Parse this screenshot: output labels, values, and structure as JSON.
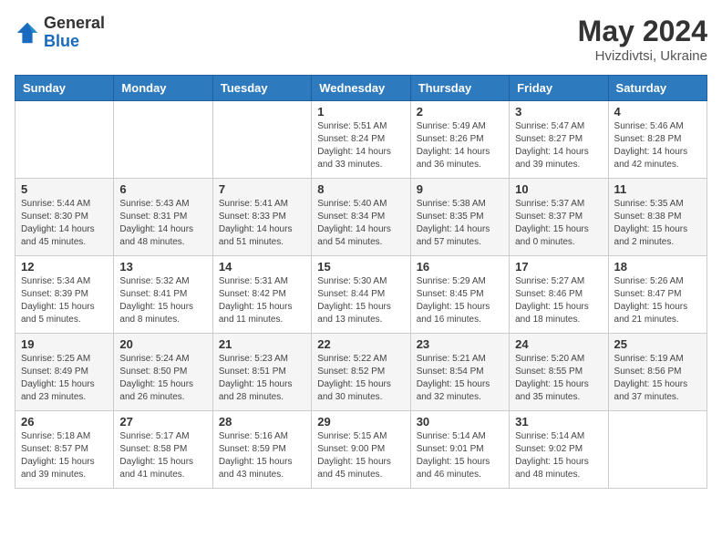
{
  "logo": {
    "general": "General",
    "blue": "Blue"
  },
  "title": {
    "month": "May 2024",
    "location": "Hvizdivtsi, Ukraine"
  },
  "weekdays": [
    "Sunday",
    "Monday",
    "Tuesday",
    "Wednesday",
    "Thursday",
    "Friday",
    "Saturday"
  ],
  "weeks": [
    [
      {
        "day": "",
        "sunrise": "",
        "sunset": "",
        "daylight": ""
      },
      {
        "day": "",
        "sunrise": "",
        "sunset": "",
        "daylight": ""
      },
      {
        "day": "",
        "sunrise": "",
        "sunset": "",
        "daylight": ""
      },
      {
        "day": "1",
        "sunrise": "Sunrise: 5:51 AM",
        "sunset": "Sunset: 8:24 PM",
        "daylight": "Daylight: 14 hours and 33 minutes."
      },
      {
        "day": "2",
        "sunrise": "Sunrise: 5:49 AM",
        "sunset": "Sunset: 8:26 PM",
        "daylight": "Daylight: 14 hours and 36 minutes."
      },
      {
        "day": "3",
        "sunrise": "Sunrise: 5:47 AM",
        "sunset": "Sunset: 8:27 PM",
        "daylight": "Daylight: 14 hours and 39 minutes."
      },
      {
        "day": "4",
        "sunrise": "Sunrise: 5:46 AM",
        "sunset": "Sunset: 8:28 PM",
        "daylight": "Daylight: 14 hours and 42 minutes."
      }
    ],
    [
      {
        "day": "5",
        "sunrise": "Sunrise: 5:44 AM",
        "sunset": "Sunset: 8:30 PM",
        "daylight": "Daylight: 14 hours and 45 minutes."
      },
      {
        "day": "6",
        "sunrise": "Sunrise: 5:43 AM",
        "sunset": "Sunset: 8:31 PM",
        "daylight": "Daylight: 14 hours and 48 minutes."
      },
      {
        "day": "7",
        "sunrise": "Sunrise: 5:41 AM",
        "sunset": "Sunset: 8:33 PM",
        "daylight": "Daylight: 14 hours and 51 minutes."
      },
      {
        "day": "8",
        "sunrise": "Sunrise: 5:40 AM",
        "sunset": "Sunset: 8:34 PM",
        "daylight": "Daylight: 14 hours and 54 minutes."
      },
      {
        "day": "9",
        "sunrise": "Sunrise: 5:38 AM",
        "sunset": "Sunset: 8:35 PM",
        "daylight": "Daylight: 14 hours and 57 minutes."
      },
      {
        "day": "10",
        "sunrise": "Sunrise: 5:37 AM",
        "sunset": "Sunset: 8:37 PM",
        "daylight": "Daylight: 15 hours and 0 minutes."
      },
      {
        "day": "11",
        "sunrise": "Sunrise: 5:35 AM",
        "sunset": "Sunset: 8:38 PM",
        "daylight": "Daylight: 15 hours and 2 minutes."
      }
    ],
    [
      {
        "day": "12",
        "sunrise": "Sunrise: 5:34 AM",
        "sunset": "Sunset: 8:39 PM",
        "daylight": "Daylight: 15 hours and 5 minutes."
      },
      {
        "day": "13",
        "sunrise": "Sunrise: 5:32 AM",
        "sunset": "Sunset: 8:41 PM",
        "daylight": "Daylight: 15 hours and 8 minutes."
      },
      {
        "day": "14",
        "sunrise": "Sunrise: 5:31 AM",
        "sunset": "Sunset: 8:42 PM",
        "daylight": "Daylight: 15 hours and 11 minutes."
      },
      {
        "day": "15",
        "sunrise": "Sunrise: 5:30 AM",
        "sunset": "Sunset: 8:44 PM",
        "daylight": "Daylight: 15 hours and 13 minutes."
      },
      {
        "day": "16",
        "sunrise": "Sunrise: 5:29 AM",
        "sunset": "Sunset: 8:45 PM",
        "daylight": "Daylight: 15 hours and 16 minutes."
      },
      {
        "day": "17",
        "sunrise": "Sunrise: 5:27 AM",
        "sunset": "Sunset: 8:46 PM",
        "daylight": "Daylight: 15 hours and 18 minutes."
      },
      {
        "day": "18",
        "sunrise": "Sunrise: 5:26 AM",
        "sunset": "Sunset: 8:47 PM",
        "daylight": "Daylight: 15 hours and 21 minutes."
      }
    ],
    [
      {
        "day": "19",
        "sunrise": "Sunrise: 5:25 AM",
        "sunset": "Sunset: 8:49 PM",
        "daylight": "Daylight: 15 hours and 23 minutes."
      },
      {
        "day": "20",
        "sunrise": "Sunrise: 5:24 AM",
        "sunset": "Sunset: 8:50 PM",
        "daylight": "Daylight: 15 hours and 26 minutes."
      },
      {
        "day": "21",
        "sunrise": "Sunrise: 5:23 AM",
        "sunset": "Sunset: 8:51 PM",
        "daylight": "Daylight: 15 hours and 28 minutes."
      },
      {
        "day": "22",
        "sunrise": "Sunrise: 5:22 AM",
        "sunset": "Sunset: 8:52 PM",
        "daylight": "Daylight: 15 hours and 30 minutes."
      },
      {
        "day": "23",
        "sunrise": "Sunrise: 5:21 AM",
        "sunset": "Sunset: 8:54 PM",
        "daylight": "Daylight: 15 hours and 32 minutes."
      },
      {
        "day": "24",
        "sunrise": "Sunrise: 5:20 AM",
        "sunset": "Sunset: 8:55 PM",
        "daylight": "Daylight: 15 hours and 35 minutes."
      },
      {
        "day": "25",
        "sunrise": "Sunrise: 5:19 AM",
        "sunset": "Sunset: 8:56 PM",
        "daylight": "Daylight: 15 hours and 37 minutes."
      }
    ],
    [
      {
        "day": "26",
        "sunrise": "Sunrise: 5:18 AM",
        "sunset": "Sunset: 8:57 PM",
        "daylight": "Daylight: 15 hours and 39 minutes."
      },
      {
        "day": "27",
        "sunrise": "Sunrise: 5:17 AM",
        "sunset": "Sunset: 8:58 PM",
        "daylight": "Daylight: 15 hours and 41 minutes."
      },
      {
        "day": "28",
        "sunrise": "Sunrise: 5:16 AM",
        "sunset": "Sunset: 8:59 PM",
        "daylight": "Daylight: 15 hours and 43 minutes."
      },
      {
        "day": "29",
        "sunrise": "Sunrise: 5:15 AM",
        "sunset": "Sunset: 9:00 PM",
        "daylight": "Daylight: 15 hours and 45 minutes."
      },
      {
        "day": "30",
        "sunrise": "Sunrise: 5:14 AM",
        "sunset": "Sunset: 9:01 PM",
        "daylight": "Daylight: 15 hours and 46 minutes."
      },
      {
        "day": "31",
        "sunrise": "Sunrise: 5:14 AM",
        "sunset": "Sunset: 9:02 PM",
        "daylight": "Daylight: 15 hours and 48 minutes."
      },
      {
        "day": "",
        "sunrise": "",
        "sunset": "",
        "daylight": ""
      }
    ]
  ]
}
